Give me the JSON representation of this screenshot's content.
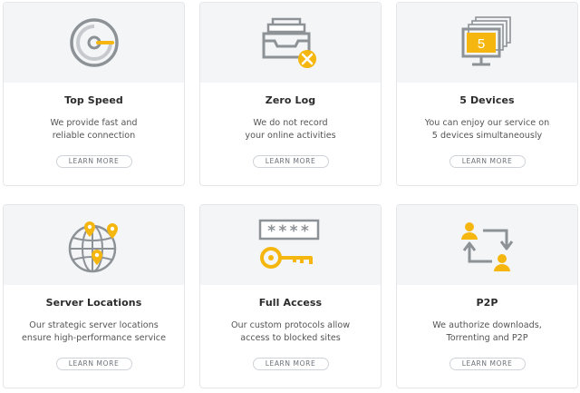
{
  "cards": [
    {
      "title": "Top Speed",
      "desc1": "We provide fast and",
      "desc2": "reliable connection",
      "button": "LEARN MORE",
      "icon": "speedometer-icon"
    },
    {
      "title": "Zero Log",
      "desc1": "We do not record",
      "desc2": "your online activities",
      "button": "LEARN MORE",
      "icon": "archive-box-x-icon"
    },
    {
      "title": "5 Devices",
      "desc1": "You can enjoy our service on",
      "desc2": "5 devices simultaneously",
      "button": "LEARN MORE",
      "icon": "stacked-monitors-icon",
      "badge": "5"
    },
    {
      "title": "Server Locations",
      "desc1": "Our strategic server locations",
      "desc2": "ensure high-performance service",
      "button": "LEARN MORE",
      "icon": "globe-pins-icon"
    },
    {
      "title": "Full Access",
      "desc1": "Our custom protocols allow",
      "desc2": "access to blocked sites",
      "button": "LEARN MORE",
      "icon": "password-key-icon",
      "password": "****"
    },
    {
      "title": "P2P",
      "desc1": "We authorize downloads,",
      "desc2": "Torrenting and P2P",
      "button": "LEARN MORE",
      "icon": "peer-to-peer-icon"
    }
  ],
  "colors": {
    "accent": "#f5b70f",
    "icon_gray": "#8d9297",
    "panel": "#f4f5f7"
  }
}
